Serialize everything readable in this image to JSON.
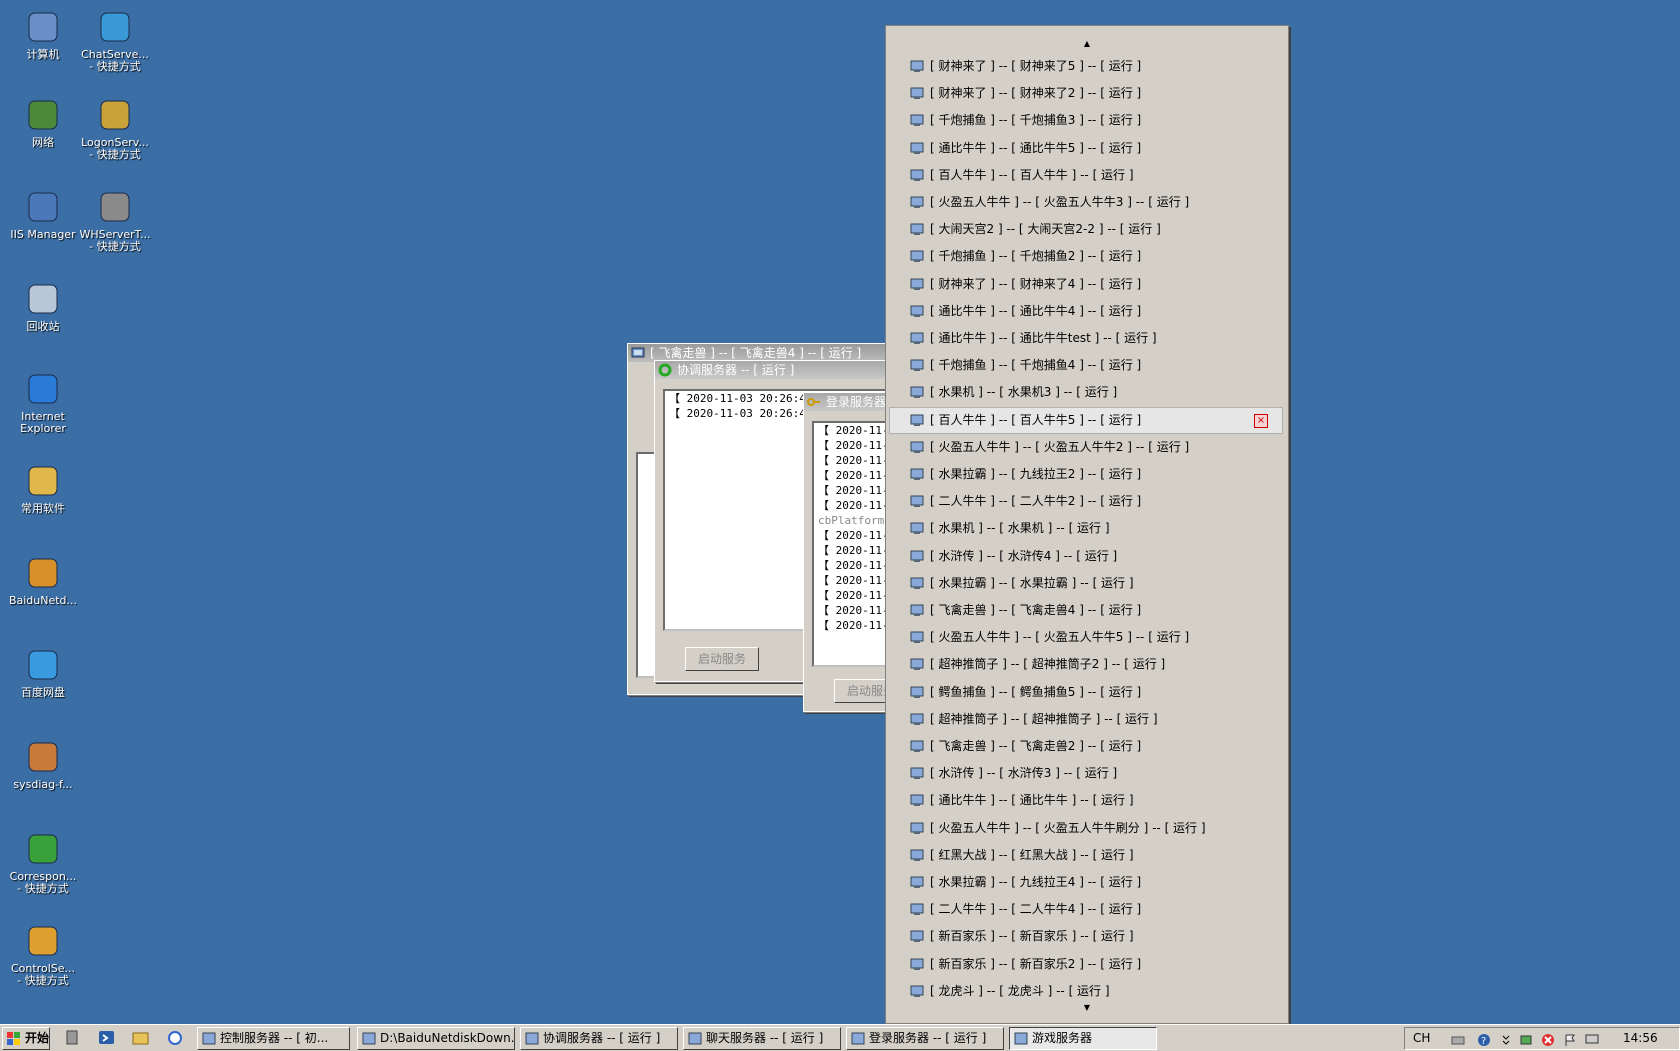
{
  "desktop": {
    "icons": [
      {
        "name": "computer-icon",
        "label": "计算机"
      },
      {
        "name": "chatserver-shortcut-icon",
        "label": "ChatServe...\n- 快捷方式"
      },
      {
        "name": "network-icon",
        "label": "网络"
      },
      {
        "name": "logonserver-shortcut-icon",
        "label": "LogonServ...\n- 快捷方式"
      },
      {
        "name": "iis-manager-icon",
        "label": "IIS Manager"
      },
      {
        "name": "whservert-shortcut-icon",
        "label": "WHServerT...\n- 快捷方式"
      },
      {
        "name": "recycle-bin-icon",
        "label": "回收站"
      },
      {
        "name": "internet-explorer-icon",
        "label": "Internet\nExplorer"
      },
      {
        "name": "common-software-folder-icon",
        "label": "常用软件"
      },
      {
        "name": "baidunetdisk-download-icon",
        "label": "BaiduNetd..."
      },
      {
        "name": "baidu-netdisk-icon",
        "label": "百度网盘"
      },
      {
        "name": "sysdiag-icon",
        "label": "sysdiag-f..."
      },
      {
        "name": "correspond-shortcut-icon",
        "label": "Correspon...\n- 快捷方式"
      },
      {
        "name": "controlserver-shortcut-icon",
        "label": "ControlSe...\n- 快捷方式"
      }
    ]
  },
  "windows": {
    "game_window": {
      "title": "[ 飞禽走兽 ] -- [ 飞禽走兽4 ] -- [ 运行 ]"
    },
    "coord_window": {
      "title": "协调服务器 -- [ 运行 ]",
      "log": [
        "【 2020-11-03 20:26:44",
        "【 2020-11-03 20:26:44"
      ],
      "start_button": "启动服务"
    },
    "login_window": {
      "title": "登录服务器 -- [ 运行 ]",
      "log": [
        "【 2020-11-1",
        "【 2020-11-1",
        "【 2020-11-1",
        "【 2020-11-1",
        "【 2020-11-1",
        "【 2020-11-1",
        "cbPlatformID",
        "【 2020-11-1",
        "【 2020-11-1",
        "【 2020-11-1",
        "【 2020-11-1",
        "【 2020-11-1",
        "【 2020-11-1",
        "【 2020-11-1"
      ],
      "start_button": "启动服务"
    }
  },
  "menu": {
    "items": [
      "[ 财神来了 ] -- [ 财神来了5 ] -- [ 运行 ]",
      "[ 财神来了 ] -- [ 财神来了2 ] -- [ 运行 ]",
      "[ 千炮捕鱼 ] -- [ 千炮捕鱼3 ] -- [ 运行 ]",
      "[ 通比牛牛 ] -- [ 通比牛牛5 ] -- [ 运行 ]",
      "[ 百人牛牛 ] -- [ 百人牛牛 ] -- [ 运行 ]",
      "[ 火盈五人牛牛 ] -- [ 火盈五人牛牛3 ] -- [ 运行 ]",
      "[ 大闹天宫2 ] -- [ 大闹天宫2-2 ] -- [ 运行 ]",
      "[ 千炮捕鱼 ] -- [ 千炮捕鱼2 ] -- [ 运行 ]",
      "[ 财神来了 ] -- [ 财神来了4 ] -- [ 运行 ]",
      "[ 通比牛牛 ] -- [ 通比牛牛4 ] -- [ 运行 ]",
      "[ 通比牛牛 ] -- [ 通比牛牛test ] -- [ 运行 ]",
      "[ 千炮捕鱼 ] -- [ 千炮捕鱼4 ] -- [ 运行 ]",
      "[ 水果机 ] -- [ 水果机3 ] -- [ 运行 ]",
      "[ 百人牛牛 ] -- [ 百人牛牛5 ] -- [ 运行 ]",
      "[ 火盈五人牛牛 ] -- [ 火盈五人牛牛2 ] -- [ 运行 ]",
      "[ 水果拉霸 ] -- [ 九线拉王2 ] -- [ 运行 ]",
      "[ 二人牛牛 ] -- [ 二人牛牛2 ] -- [ 运行 ]",
      "[ 水果机 ] -- [ 水果机 ] -- [ 运行 ]",
      "[ 水浒传 ] -- [ 水浒传4 ] -- [ 运行 ]",
      "[ 水果拉霸 ] -- [ 水果拉霸 ] -- [ 运行 ]",
      "[ 飞禽走兽 ] -- [ 飞禽走兽4 ] -- [ 运行 ]",
      "[ 火盈五人牛牛 ] -- [ 火盈五人牛牛5 ] -- [ 运行 ]",
      "[ 超神推筒子 ] -- [ 超神推筒子2 ] -- [ 运行 ]",
      "[ 鳄鱼捕鱼 ] -- [ 鳄鱼捕鱼5 ] -- [ 运行 ]",
      "[ 超神推筒子 ] -- [ 超神推筒子 ] -- [ 运行 ]",
      "[ 飞禽走兽 ] -- [ 飞禽走兽2 ] -- [ 运行 ]",
      "[ 水浒传 ] -- [ 水浒传3 ] -- [ 运行 ]",
      "[ 通比牛牛 ] -- [ 通比牛牛 ] -- [ 运行 ]",
      "[ 火盈五人牛牛 ] -- [ 火盈五人牛牛刷分 ] -- [ 运行 ]",
      "[ 红黑大战 ] -- [ 红黑大战 ] -- [ 运行 ]",
      "[ 水果拉霸 ] -- [ 九线拉王4 ] -- [ 运行 ]",
      "[ 二人牛牛 ] -- [ 二人牛牛4 ] -- [ 运行 ]",
      "[ 新百家乐 ] -- [ 新百家乐 ] -- [ 运行 ]",
      "[ 新百家乐 ] -- [ 新百家乐2 ] -- [ 运行 ]",
      "[ 龙虎斗 ] -- [ 龙虎斗 ] -- [ 运行 ]"
    ],
    "hover_index": 13,
    "close_glyph": "×",
    "scroll_up_glyph": "▲",
    "scroll_down_glyph": "▼"
  },
  "taskbar": {
    "start_label": "开始",
    "buttons": [
      "控制服务器 -- [ 初...",
      "D:\\BaiduNetdiskDown...",
      "协调服务器 -- [ 运行 ]",
      "聊天服务器 -- [ 运行 ]",
      "登录服务器 -- [ 运行 ]",
      "游戏服务器"
    ],
    "language": "CH",
    "clock": "14:56"
  },
  "colors": {
    "desktop": "#3a6ea5",
    "menu_bg": "#d4d0c8",
    "hover": "#e6e6e6"
  }
}
